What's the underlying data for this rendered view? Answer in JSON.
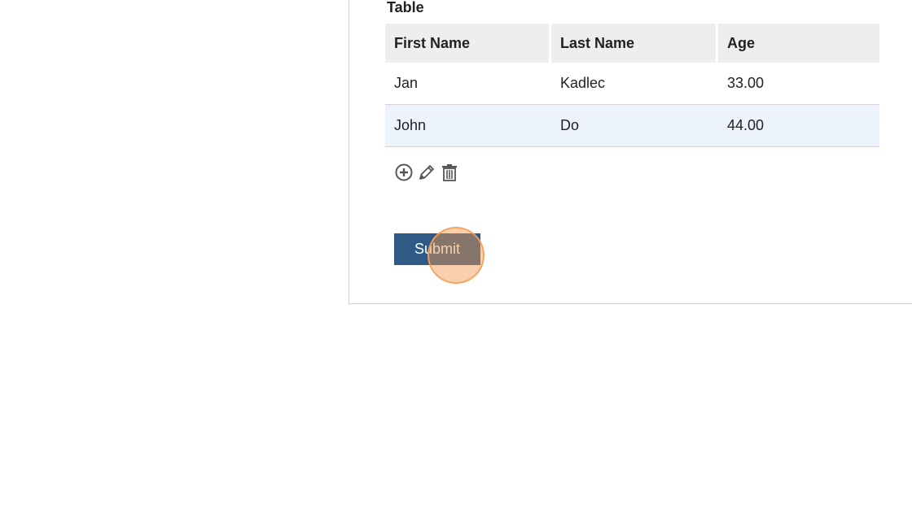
{
  "section": {
    "title": "Table"
  },
  "table": {
    "headers": [
      "First Name",
      "Last Name",
      "Age"
    ],
    "rows": [
      [
        "Jan",
        "Kadlec",
        "33.00"
      ],
      [
        "John",
        "Do",
        "44.00"
      ]
    ],
    "selected_row_index": 1
  },
  "actions": {
    "add_icon": "add-circle-icon",
    "edit_icon": "pencil-icon",
    "delete_icon": "trash-icon"
  },
  "submit": {
    "label": "Submit"
  },
  "colors": {
    "header_bg": "#eeeeee",
    "selected_row_bg": "#ecf3fd",
    "submit_bg": "#2f5a86",
    "click_marker": "#f2964b"
  }
}
